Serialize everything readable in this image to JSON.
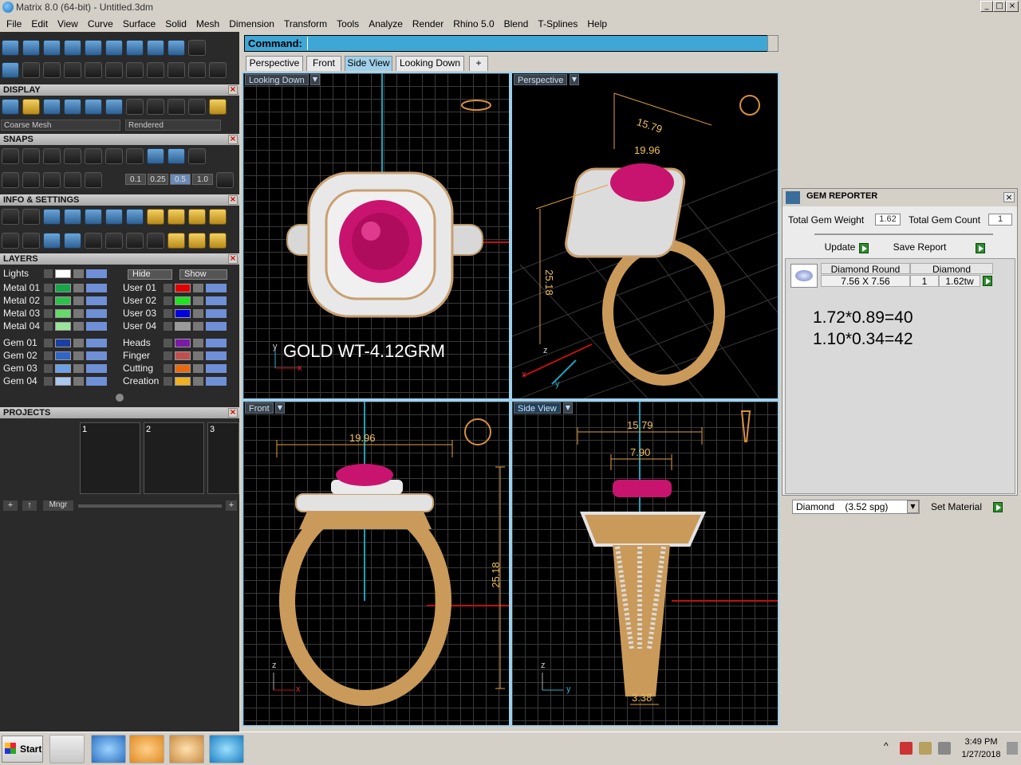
{
  "window": {
    "title": "Matrix 8.0 (64-bit) - Untitled.3dm",
    "min": "_",
    "restore": "□",
    "close": "×"
  },
  "menu": [
    "File",
    "Edit",
    "View",
    "Curve",
    "Surface",
    "Solid",
    "Mesh",
    "Dimension",
    "Transform",
    "Tools",
    "Analyze",
    "Render",
    "Rhino 5.0",
    "Blend",
    "T-Splines",
    "Help"
  ],
  "left": {
    "display": {
      "title": "DISPLAY",
      "mesh": "Coarse Mesh",
      "mode": "Rendered"
    },
    "snaps": {
      "title": "SNAPS",
      "values": [
        "0.1",
        "0.25",
        "0.5",
        "1.0"
      ]
    },
    "info": {
      "title": "INFO & SETTINGS"
    },
    "layers": {
      "title": "LAYERS",
      "lights": "Lights",
      "hide": "Hide",
      "show": "Show",
      "left": [
        {
          "name": "Metal 01",
          "color": "#17a54a"
        },
        {
          "name": "Metal 02",
          "color": "#2fbf4c"
        },
        {
          "name": "Metal 03",
          "color": "#67d86a"
        },
        {
          "name": "Metal 04",
          "color": "#9be29b"
        },
        {
          "name": "Gem 01",
          "color": "#1a3fa0"
        },
        {
          "name": "Gem 02",
          "color": "#2f65c8"
        },
        {
          "name": "Gem 03",
          "color": "#6aa1e8"
        },
        {
          "name": "Gem 04",
          "color": "#a9c8f0"
        }
      ],
      "right": [
        {
          "name": "User 01",
          "color": "#e00000"
        },
        {
          "name": "User 02",
          "color": "#22e022"
        },
        {
          "name": "User 03",
          "color": "#0000e0"
        },
        {
          "name": "User 04",
          "color": "#9a9a9a"
        },
        {
          "name": "Heads",
          "color": "#7a1aa8"
        },
        {
          "name": "Finger",
          "color": "#c05050"
        },
        {
          "name": "Cutting",
          "color": "#e86a10"
        },
        {
          "name": "Creation",
          "color": "#f0b020"
        }
      ]
    },
    "projects": {
      "title": "PROJECTS",
      "slots": [
        "1",
        "2",
        "3"
      ],
      "mngr": "Mngr"
    }
  },
  "command": {
    "label": "Command:",
    "value": ""
  },
  "tabs": [
    "Perspective",
    "Front",
    "Side View",
    "Looking Down"
  ],
  "viewports": {
    "top_left": {
      "label": "Looking Down",
      "text": "GOLD WT-4.12GRM",
      "axis_y": "y",
      "axis_x": "x"
    },
    "top_right": {
      "label": "Perspective",
      "dims": [
        "15.79",
        "19.96",
        "25.18"
      ],
      "axis_x": "x",
      "axis_y": "y",
      "axis_z": "z"
    },
    "bottom_left": {
      "label": "Front",
      "dims": [
        "19.96",
        "25.18"
      ],
      "axis_z": "z",
      "axis_x": "x"
    },
    "bottom_right": {
      "label": "Side View",
      "dims": [
        "15.79",
        "7.90",
        "3.38"
      ],
      "axis_z": "z",
      "axis_y": "y"
    }
  },
  "gem_reporter": {
    "title": "GEM REPORTER",
    "total_weight_label": "Total Gem Weight",
    "total_weight": "1.62",
    "total_count_label": "Total Gem Count",
    "total_count": "1",
    "update": "Update",
    "save_report": "Save Report",
    "columns": [
      "Diamond Round",
      "Diamond"
    ],
    "row": {
      "size": "7.56 X 7.56",
      "count": "1",
      "tw": "1.62tw"
    },
    "notes": [
      "1.72*0.89=40",
      "1.10*0.34=42"
    ],
    "material": "Diamond    (3.52 spg)",
    "set_material": "Set Material"
  },
  "taskbar": {
    "start": "Start",
    "time": "3:49 PM",
    "date": "1/27/2018"
  }
}
